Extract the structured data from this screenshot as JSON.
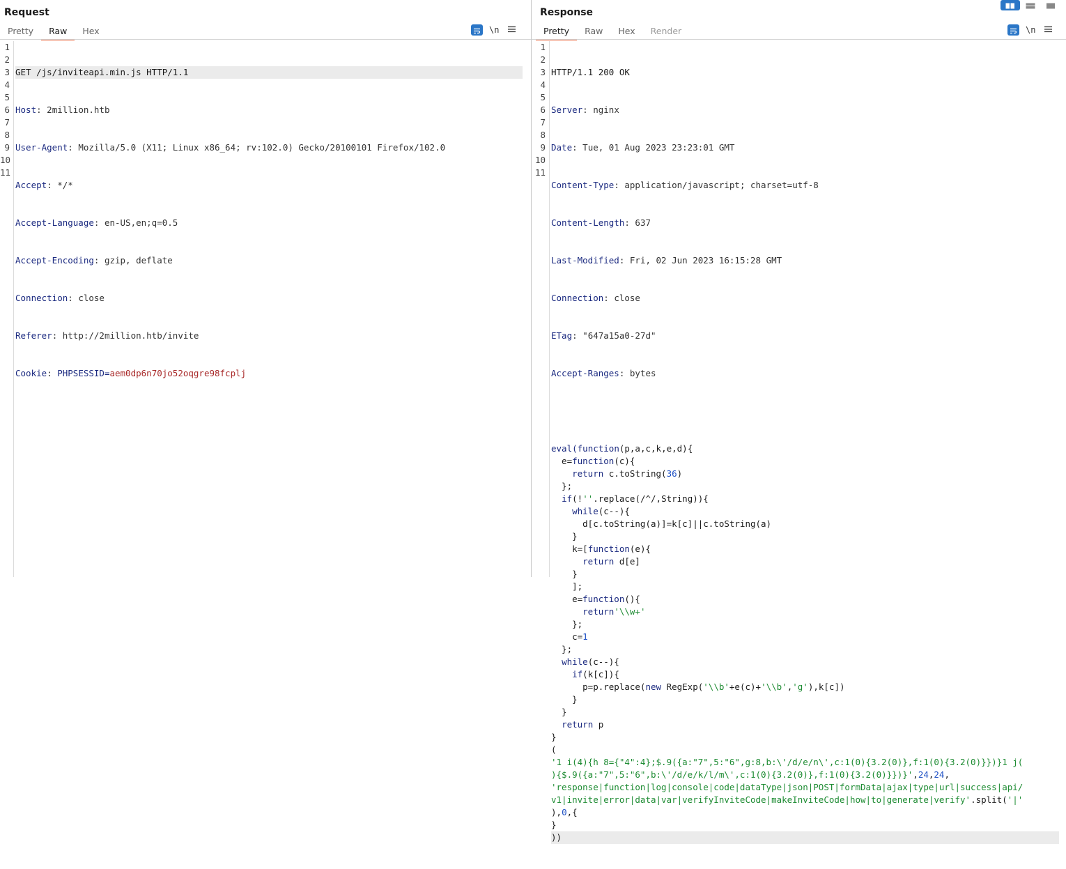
{
  "request": {
    "title": "Request",
    "tabs": [
      {
        "label": "Pretty",
        "active": false
      },
      {
        "label": "Raw",
        "active": true
      },
      {
        "label": "Hex",
        "active": false
      }
    ],
    "tools": {
      "wrap_icon": "wrap-lines-icon",
      "newline_label": "\\n",
      "menu_icon": "hamburger-menu-icon"
    },
    "line_numbers": [
      "1",
      "2",
      "3",
      "4",
      "5",
      "6",
      "7",
      "8",
      "9",
      "10",
      "11"
    ],
    "request_line": "GET /js/inviteapi.min.js HTTP/1.1",
    "headers": [
      {
        "name": "Host",
        "value": "2million.htb"
      },
      {
        "name": "User-Agent",
        "value": "Mozilla/5.0 (X11; Linux x86_64; rv:102.0) Gecko/20100101 Firefox/102.0"
      },
      {
        "name": "Accept",
        "value": "*/*"
      },
      {
        "name": "Accept-Language",
        "value": "en-US,en;q=0.5"
      },
      {
        "name": "Accept-Encoding",
        "value": "gzip, deflate"
      },
      {
        "name": "Connection",
        "value": "close"
      },
      {
        "name": "Referer",
        "value": "http://2million.htb/invite"
      }
    ],
    "cookie": {
      "name": "Cookie",
      "key": "PHPSESSID",
      "value": "aem0dp6n70jo52oqgre98fcplj"
    }
  },
  "response": {
    "title": "Response",
    "tabs": [
      {
        "label": "Pretty",
        "active": true
      },
      {
        "label": "Raw",
        "active": false
      },
      {
        "label": "Hex",
        "active": false
      },
      {
        "label": "Render",
        "active": false
      }
    ],
    "tools": {
      "wrap_icon": "wrap-lines-icon",
      "newline_label": "\\n",
      "menu_icon": "hamburger-menu-icon"
    },
    "line_numbers": [
      "1",
      "2",
      "3",
      "4",
      "5",
      "6",
      "7",
      "8",
      "9",
      "10",
      "11"
    ],
    "status_line": "HTTP/1.1 200 OK",
    "headers": [
      {
        "name": "Server",
        "value": "nginx"
      },
      {
        "name": "Date",
        "value": "Tue, 01 Aug 2023 23:23:01 GMT"
      },
      {
        "name": "Content-Type",
        "value": "application/javascript; charset=utf-8"
      },
      {
        "name": "Content-Length",
        "value": "637"
      },
      {
        "name": "Last-Modified",
        "value": "Fri, 02 Jun 2023 16:15:28 GMT"
      },
      {
        "name": "Connection",
        "value": "close"
      },
      {
        "name": "ETag",
        "value": "\"647a15a0-27d\""
      },
      {
        "name": "Accept-Ranges",
        "value": "bytes"
      }
    ],
    "body_lines": [
      [
        [
          "kw",
          "eval("
        ],
        [
          "kw",
          "function"
        ],
        [
          "pl",
          "(p,a,c,k,e,d){"
        ]
      ],
      [
        [
          "pl",
          "  e="
        ],
        [
          "kw",
          "function"
        ],
        [
          "pl",
          "(c){"
        ]
      ],
      [
        [
          "pl",
          "    "
        ],
        [
          "kw",
          "return"
        ],
        [
          "pl",
          " c.toString("
        ],
        [
          "num",
          "36"
        ],
        [
          "pl",
          ")"
        ]
      ],
      [
        [
          "pl",
          "  };"
        ]
      ],
      [
        [
          "pl",
          "  "
        ],
        [
          "kw",
          "if"
        ],
        [
          "pl",
          "(!"
        ],
        [
          "str",
          "''"
        ],
        [
          "pl",
          ".replace(/^/,String)){"
        ]
      ],
      [
        [
          "pl",
          "    "
        ],
        [
          "kw",
          "while"
        ],
        [
          "pl",
          "(c--){"
        ]
      ],
      [
        [
          "pl",
          "      d[c.toString(a)]=k[c]||c.toString(a)"
        ]
      ],
      [
        [
          "pl",
          "    }"
        ]
      ],
      [
        [
          "pl",
          "    k=["
        ],
        [
          "kw",
          "function"
        ],
        [
          "pl",
          "(e){"
        ]
      ],
      [
        [
          "pl",
          "      "
        ],
        [
          "kw",
          "return"
        ],
        [
          "pl",
          " d[e]"
        ]
      ],
      [
        [
          "pl",
          "    }"
        ]
      ],
      [
        [
          "pl",
          "    ];"
        ]
      ],
      [
        [
          "pl",
          "    e="
        ],
        [
          "kw",
          "function"
        ],
        [
          "pl",
          "(){"
        ]
      ],
      [
        [
          "pl",
          "      "
        ],
        [
          "kw",
          "return"
        ],
        [
          "str",
          "'\\\\w+'"
        ]
      ],
      [
        [
          "pl",
          "    };"
        ]
      ],
      [
        [
          "pl",
          "    c="
        ],
        [
          "num",
          "1"
        ]
      ],
      [
        [
          "pl",
          "  };"
        ]
      ],
      [
        [
          "pl",
          "  "
        ],
        [
          "kw",
          "while"
        ],
        [
          "pl",
          "(c--){"
        ]
      ],
      [
        [
          "pl",
          "    "
        ],
        [
          "kw",
          "if"
        ],
        [
          "pl",
          "(k[c]){"
        ]
      ],
      [
        [
          "pl",
          "      p=p.replace("
        ],
        [
          "kw",
          "new"
        ],
        [
          "pl",
          " RegExp("
        ],
        [
          "str",
          "'\\\\b'"
        ],
        [
          "pl",
          "+e(c)+"
        ],
        [
          "str",
          "'\\\\b'"
        ],
        [
          "pl",
          ","
        ],
        [
          "str",
          "'g'"
        ],
        [
          "pl",
          "),k[c])"
        ]
      ],
      [
        [
          "pl",
          "    }"
        ]
      ],
      [
        [
          "pl",
          "  }"
        ]
      ],
      [
        [
          "pl",
          "  "
        ],
        [
          "kw",
          "return"
        ],
        [
          "pl",
          " p"
        ]
      ],
      [
        [
          "pl",
          "}"
        ]
      ],
      [
        [
          "pl",
          "("
        ]
      ],
      [
        [
          "str",
          "'1 i(4){h 8={\"4\":4};$.9({a:\"7\",5:\"6\",g:8,b:\\'/d/e/n\\',c:1(0){3.2(0)},f:1(0){3.2(0)}})}1 j("
        ]
      ],
      [
        [
          "str",
          "){$.9({a:\"7\",5:\"6\",b:\\'/d/e/k/l/m\\',c:1(0){3.2(0)},f:1(0){3.2(0)}})}'"
        ],
        [
          "pl",
          ","
        ],
        [
          "num",
          "24"
        ],
        [
          "pl",
          ","
        ],
        [
          "num",
          "24"
        ],
        [
          "pl",
          ","
        ]
      ],
      [
        [
          "str",
          "'response|function|log|console|code|dataType|json|POST|formData|ajax|type|url|success|api/"
        ]
      ],
      [
        [
          "str",
          "v1|invite|error|data|var|verifyInviteCode|makeInviteCode|how|to|generate|verify'"
        ],
        [
          "pl",
          ".split("
        ],
        [
          "str",
          "'|'"
        ]
      ],
      [
        [
          "pl",
          "),"
        ],
        [
          "num",
          "0"
        ],
        [
          "pl",
          ",{"
        ]
      ],
      [
        [
          "pl",
          "}"
        ]
      ],
      [
        [
          "pl",
          "))"
        ]
      ]
    ]
  },
  "layout_buttons": [
    {
      "icon": "split-horizontal-icon",
      "active": true
    },
    {
      "icon": "split-vertical-icon",
      "active": false
    },
    {
      "icon": "single-pane-icon",
      "active": false
    }
  ]
}
